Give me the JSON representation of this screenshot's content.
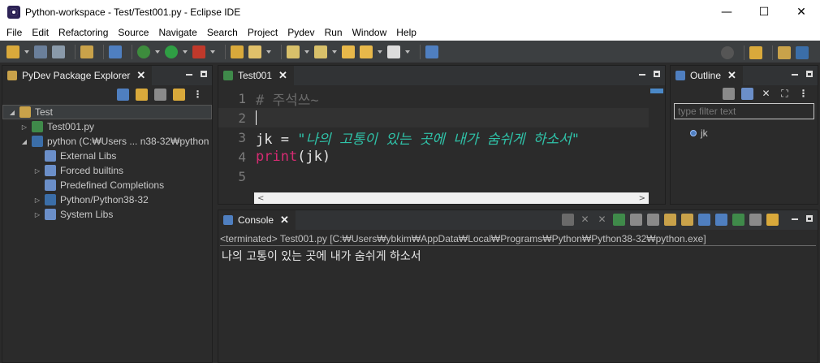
{
  "window": {
    "title": "Python-workspace - Test/Test001.py - Eclipse IDE",
    "minimize": "—",
    "maximize": "☐",
    "close": "✕"
  },
  "menu": [
    "File",
    "Edit",
    "Refactoring",
    "Source",
    "Navigate",
    "Search",
    "Project",
    "Pydev",
    "Run",
    "Window",
    "Help"
  ],
  "explorer": {
    "tab_label": "PyDev Package Explorer",
    "items": [
      {
        "label": "Test",
        "expander": "◢"
      },
      {
        "label": "Test001.py",
        "expander": "▷"
      },
      {
        "label": "python  (C:₩Users ... n38-32₩python",
        "expander": "◢"
      },
      {
        "label": "External Libs",
        "expander": ""
      },
      {
        "label": "Forced builtins",
        "expander": "▷"
      },
      {
        "label": "Predefined Completions",
        "expander": ""
      },
      {
        "label": "Python/Python38-32",
        "expander": "▷"
      },
      {
        "label": "System Libs",
        "expander": "▷"
      }
    ]
  },
  "editor": {
    "tab_label": "Test001",
    "lines": [
      {
        "num": "1",
        "comment": "# 주석쓰~"
      },
      {
        "num": "2"
      },
      {
        "num": "3",
        "ident": "jk",
        "op": " = ",
        "str": "\"나의 고통이 있는 곳에 내가 숨쉬게 하소서\""
      },
      {
        "num": "4",
        "kw": "print",
        "rest": "(jk)"
      },
      {
        "num": "5"
      }
    ],
    "scroll_left": "<",
    "scroll_right": ">"
  },
  "outline": {
    "tab_label": "Outline",
    "filter_placeholder": "type filter text",
    "items": [
      {
        "label": "jk"
      }
    ]
  },
  "console": {
    "tab_label": "Console",
    "status": "<terminated> Test001.py [C:₩Users₩ybkim₩AppData₩Local₩Programs₩Python₩Python38-32₩python.exe]",
    "output": "나의 고통이 있는 곳에 내가 숨쉬게 하소서"
  },
  "colors": {
    "string": "#2fc2a8",
    "keyword": "#d62b72",
    "comment": "#6a6a6a",
    "background": "#2b2b2b"
  }
}
